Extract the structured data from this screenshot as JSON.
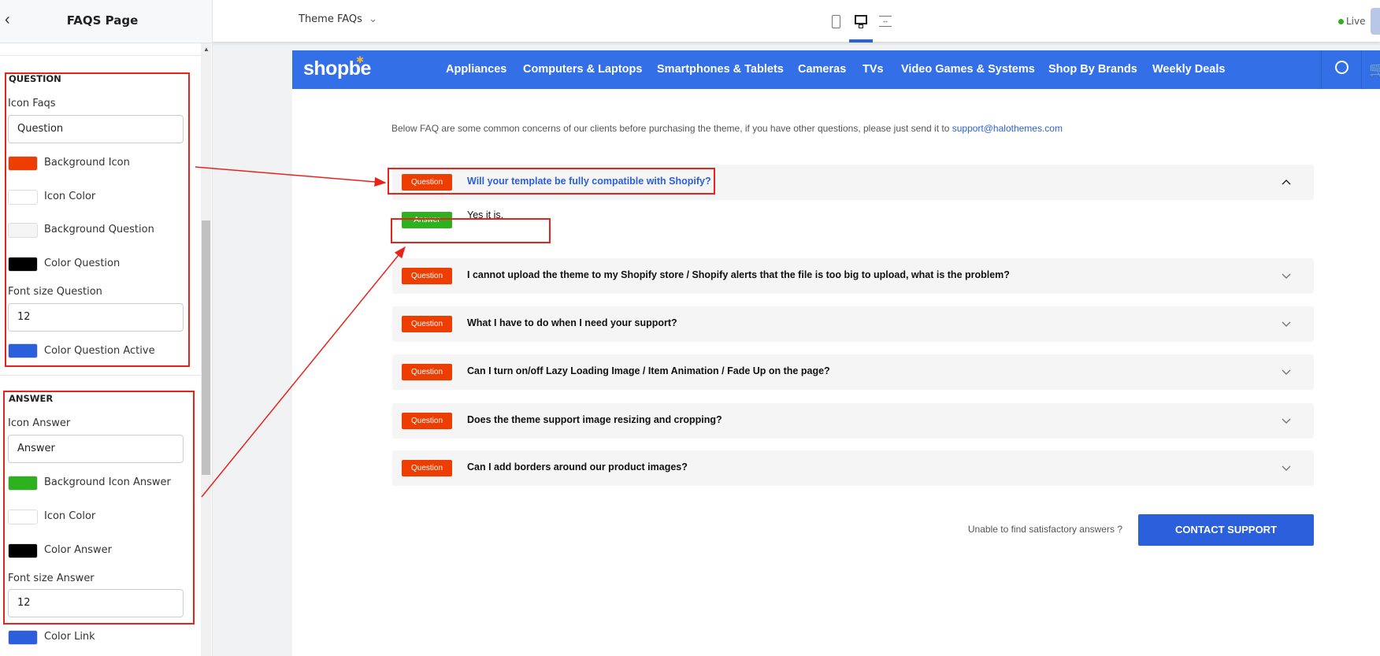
{
  "sidebar": {
    "title": "FAQS Page",
    "question": {
      "heading": "QUESTION",
      "icon_label": "Icon Faqs",
      "icon_value": "Question",
      "swatches": [
        {
          "label": "Background Icon",
          "color": "#ee3d00"
        },
        {
          "label": "Icon Color",
          "color": "#ffffff"
        },
        {
          "label": "Background Question",
          "color": "#f5f5f5"
        },
        {
          "label": "Color Question",
          "color": "#000000"
        }
      ],
      "font_label": "Font size Question",
      "font_value": "12",
      "active": {
        "label": "Color Question Active",
        "color": "#2b5fdb"
      }
    },
    "answer": {
      "heading": "ANSWER",
      "icon_label": "Icon Answer",
      "icon_value": "Answer",
      "swatches": [
        {
          "label": "Background Icon Answer",
          "color": "#2db11f"
        },
        {
          "label": "Icon Color",
          "color": "#ffffff"
        },
        {
          "label": "Color Answer",
          "color": "#000000"
        }
      ],
      "font_label": "Font size Answer",
      "font_value": "12",
      "link": {
        "label": "Color Link",
        "color": "#2b5fdb"
      }
    }
  },
  "topbar": {
    "template": "Theme FAQs",
    "status": "Live",
    "devices": [
      "mobile-icon",
      "desktop-icon",
      "fullwidth-icon"
    ],
    "active_device": "desktop"
  },
  "store": {
    "logo": "shopbe",
    "nav": [
      "Appliances",
      "Computers & Laptops",
      "Smartphones & Tablets",
      "Cameras",
      "TVs",
      "Video Games & Systems",
      "Shop By Brands",
      "Weekly Deals"
    ],
    "intro": "Below FAQ are some common concerns of our clients before purchasing the theme, if you have other questions, please just send it to ",
    "email": "support@halothemes.com",
    "question_badge": "Question",
    "answer_badge": "Answer",
    "faqs": [
      {
        "q": "Will your template be fully compatible with Shopify?",
        "a": "Yes it is.",
        "open": true
      },
      {
        "q": "I cannot upload the theme to my Shopify store / Shopify alerts that the file is too big to upload, what is the problem?",
        "open": false
      },
      {
        "q": "What I have to do when I need your support?",
        "open": false
      },
      {
        "q": "Can I turn on/off Lazy Loading Image / Item Animation / Fade Up on the page?",
        "open": false
      },
      {
        "q": "Does the theme support image resizing and cropping?",
        "open": false
      },
      {
        "q": "Can I add borders around our product images?",
        "open": false
      }
    ],
    "unable_text": "Unable to find satisfactory answers ?",
    "contact_button": "CONTACT SUPPORT"
  }
}
